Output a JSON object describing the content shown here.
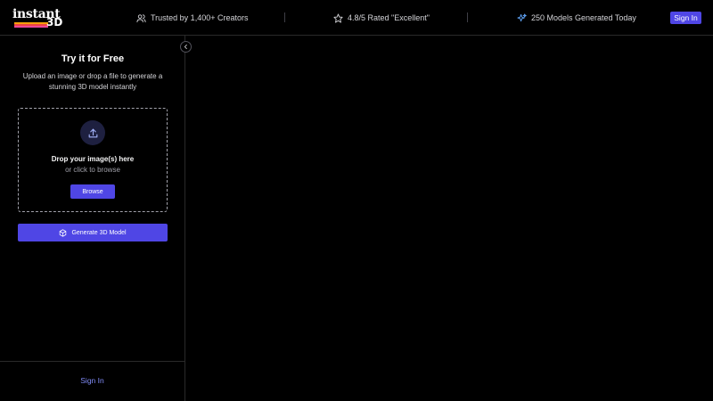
{
  "header": {
    "logo_word": "instant",
    "logo_suffix": "3D",
    "logo_stripe_colors": [
      "#f59e0b",
      "#ef4444",
      "#ec4899"
    ],
    "trust_text": "Trusted by 1,400+ Creators",
    "trust_icon": "users-icon",
    "rating_text": "4.8/5 Rated \"Excellent\"",
    "rating_icon": "star-icon",
    "models_text": "250 Models Generated Today",
    "models_icon": "sparkles-icon",
    "signin_label": "Sign In"
  },
  "panel": {
    "title": "Try it for Free",
    "description": "Upload an image or drop a file to generate a stunning 3D model instantly",
    "dropzone": {
      "icon": "upload-icon",
      "title": "Drop your image(s) here",
      "subtitle": "or click to browse",
      "browse_label": "Browse"
    },
    "generate_label": "Generate 3D Model",
    "generate_icon": "cube-icon",
    "footer_signin_label": "Sign In"
  },
  "colors": {
    "accent": "#4f46e5",
    "link": "#818cf8",
    "background": "#000000"
  }
}
